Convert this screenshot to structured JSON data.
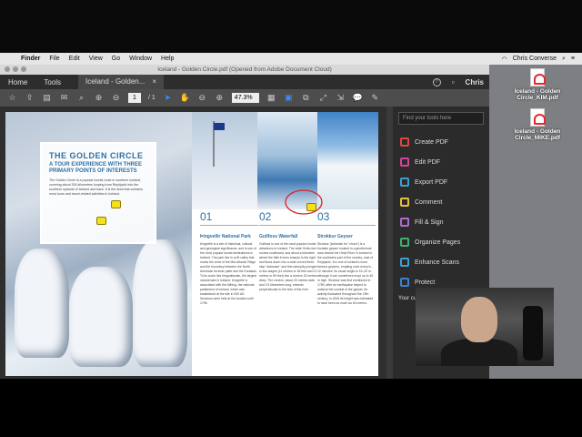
{
  "menubar": {
    "apple": "",
    "items": [
      "Finder",
      "File",
      "Edit",
      "View",
      "Go",
      "Window",
      "Help"
    ],
    "user": "Chris Converse"
  },
  "window": {
    "title": "Iceland - Golden Circle.pdf (Opened from Adobe Document Cloud)"
  },
  "tabs": {
    "home": "Home",
    "tools": "Tools",
    "doc": "Iceland - Golden...",
    "close": "×",
    "user": "Chris"
  },
  "toolbar": {
    "page_current": "1",
    "page_total": "/ 1",
    "zoom": "47.3%"
  },
  "document": {
    "title": "THE GOLDEN CIRCLE",
    "subtitle": "A TOUR EXPERIENCE WITH THREE PRIMARY POINTS OF INTERESTS",
    "intro": "The Golden Circle is a popular tourist route in southern Iceland, covering about 300 kilometres looping from Reykjavík into the southern uplands of Iceland and back. It is the area that contains most tours and travel-related activities in Iceland.",
    "columns": [
      {
        "num": "01",
        "head": "Þingvellir National Park",
        "body": "Þingvellir is a site of historical, cultural, and geological significance, and is one of the most popular tourist destinations in Iceland. The park lies in a rift valley that marks the crest of the Mid-Atlantic Ridge and the boundary between the North American tectonic plate and the Eurasian. To its south lies Þingvallavatn, the largest natural lake in Iceland. Þingvellir is associated with the Althing, the national parliament of Iceland, which was established at the site in 930 AD. Sessions were held at the location until 1798."
      },
      {
        "num": "02",
        "head": "Gullfoss Waterfall",
        "body": "Gullfoss is one of the most popular tourist attractions in Iceland. The wide Hvítá river rushes southward, and about a kilometer above the falls it turns sharply to the right and flows down into a wide curved three-step \"staircase\" and then abruptly plunges in two stages (11 metres or 36 feet and 21 metres or 69 feet) into a crevice 32 metres deep. The crevice, about 20 metres wide and 2.5 kilometres long, extends perpendicular to the flow of the river."
      },
      {
        "num": "03",
        "head": "Strokkur Geyser",
        "body": "Strokkur (Icelandic for \"churn\") is a fountain geyser located in a geothermal area beside the Hvítá River in Iceland in the southwest part of the country, east of Reykjavík. It is one of Iceland's most famous geysers, erupting once every 6–10 minutes. Its usual height is 15–20 m, although it can sometimes erupt up to 40 m high. Strokkur was first mentioned in 1789, after an earthquake helped to unblock the conduit of the geyser. Its activity fluctuated throughout the 19th century; in 1815 its height was estimated to have been as much as 60 metres."
      }
    ]
  },
  "tools_pane": {
    "search_placeholder": "Find your tools here",
    "items": [
      {
        "label": "Create PDF",
        "color": "#e0483e"
      },
      {
        "label": "Edit PDF",
        "color": "#d8409a"
      },
      {
        "label": "Export PDF",
        "color": "#3aa0d6"
      },
      {
        "label": "Comment",
        "color": "#e6c33a"
      },
      {
        "label": "Fill & Sign",
        "color": "#b069d6"
      },
      {
        "label": "Organize Pages",
        "color": "#3fb36b"
      },
      {
        "label": "Enhance Scans",
        "color": "#3aa0d6"
      },
      {
        "label": "Protect",
        "color": "#3a82d6"
      }
    ],
    "footer": "Your cu"
  },
  "desktop": {
    "files": [
      "Iceland - Golden Circle_KIM.pdf",
      "Iceland - Golden Circle_MIKE.pdf"
    ]
  }
}
